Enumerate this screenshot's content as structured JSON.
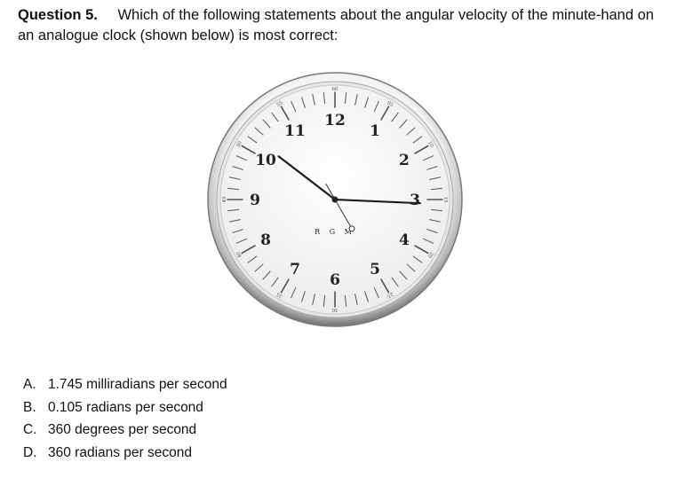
{
  "question": {
    "number": "Question 5.",
    "text": "Which of the following statements about the angular velocity of the minute-hand on an analogue clock (shown below) is most correct:"
  },
  "clock": {
    "numerals": [
      "12",
      "1",
      "2",
      "3",
      "4",
      "5",
      "6",
      "7",
      "8",
      "9",
      "10",
      "11"
    ],
    "minute_labels": [
      "60",
      "05",
      "10",
      "15",
      "20",
      "25",
      "30",
      "35",
      "40",
      "45",
      "50",
      "55"
    ],
    "brand": "R G M",
    "time_shown": {
      "hour": 10,
      "minute": 15,
      "second": 25
    }
  },
  "options": [
    {
      "letter": "A.",
      "text": "1.745 milliradians per second"
    },
    {
      "letter": "B.",
      "text": "0.105 radians per second"
    },
    {
      "letter": "C.",
      "text": "360 degrees per second"
    },
    {
      "letter": "D.",
      "text": "360 radians per second"
    }
  ]
}
